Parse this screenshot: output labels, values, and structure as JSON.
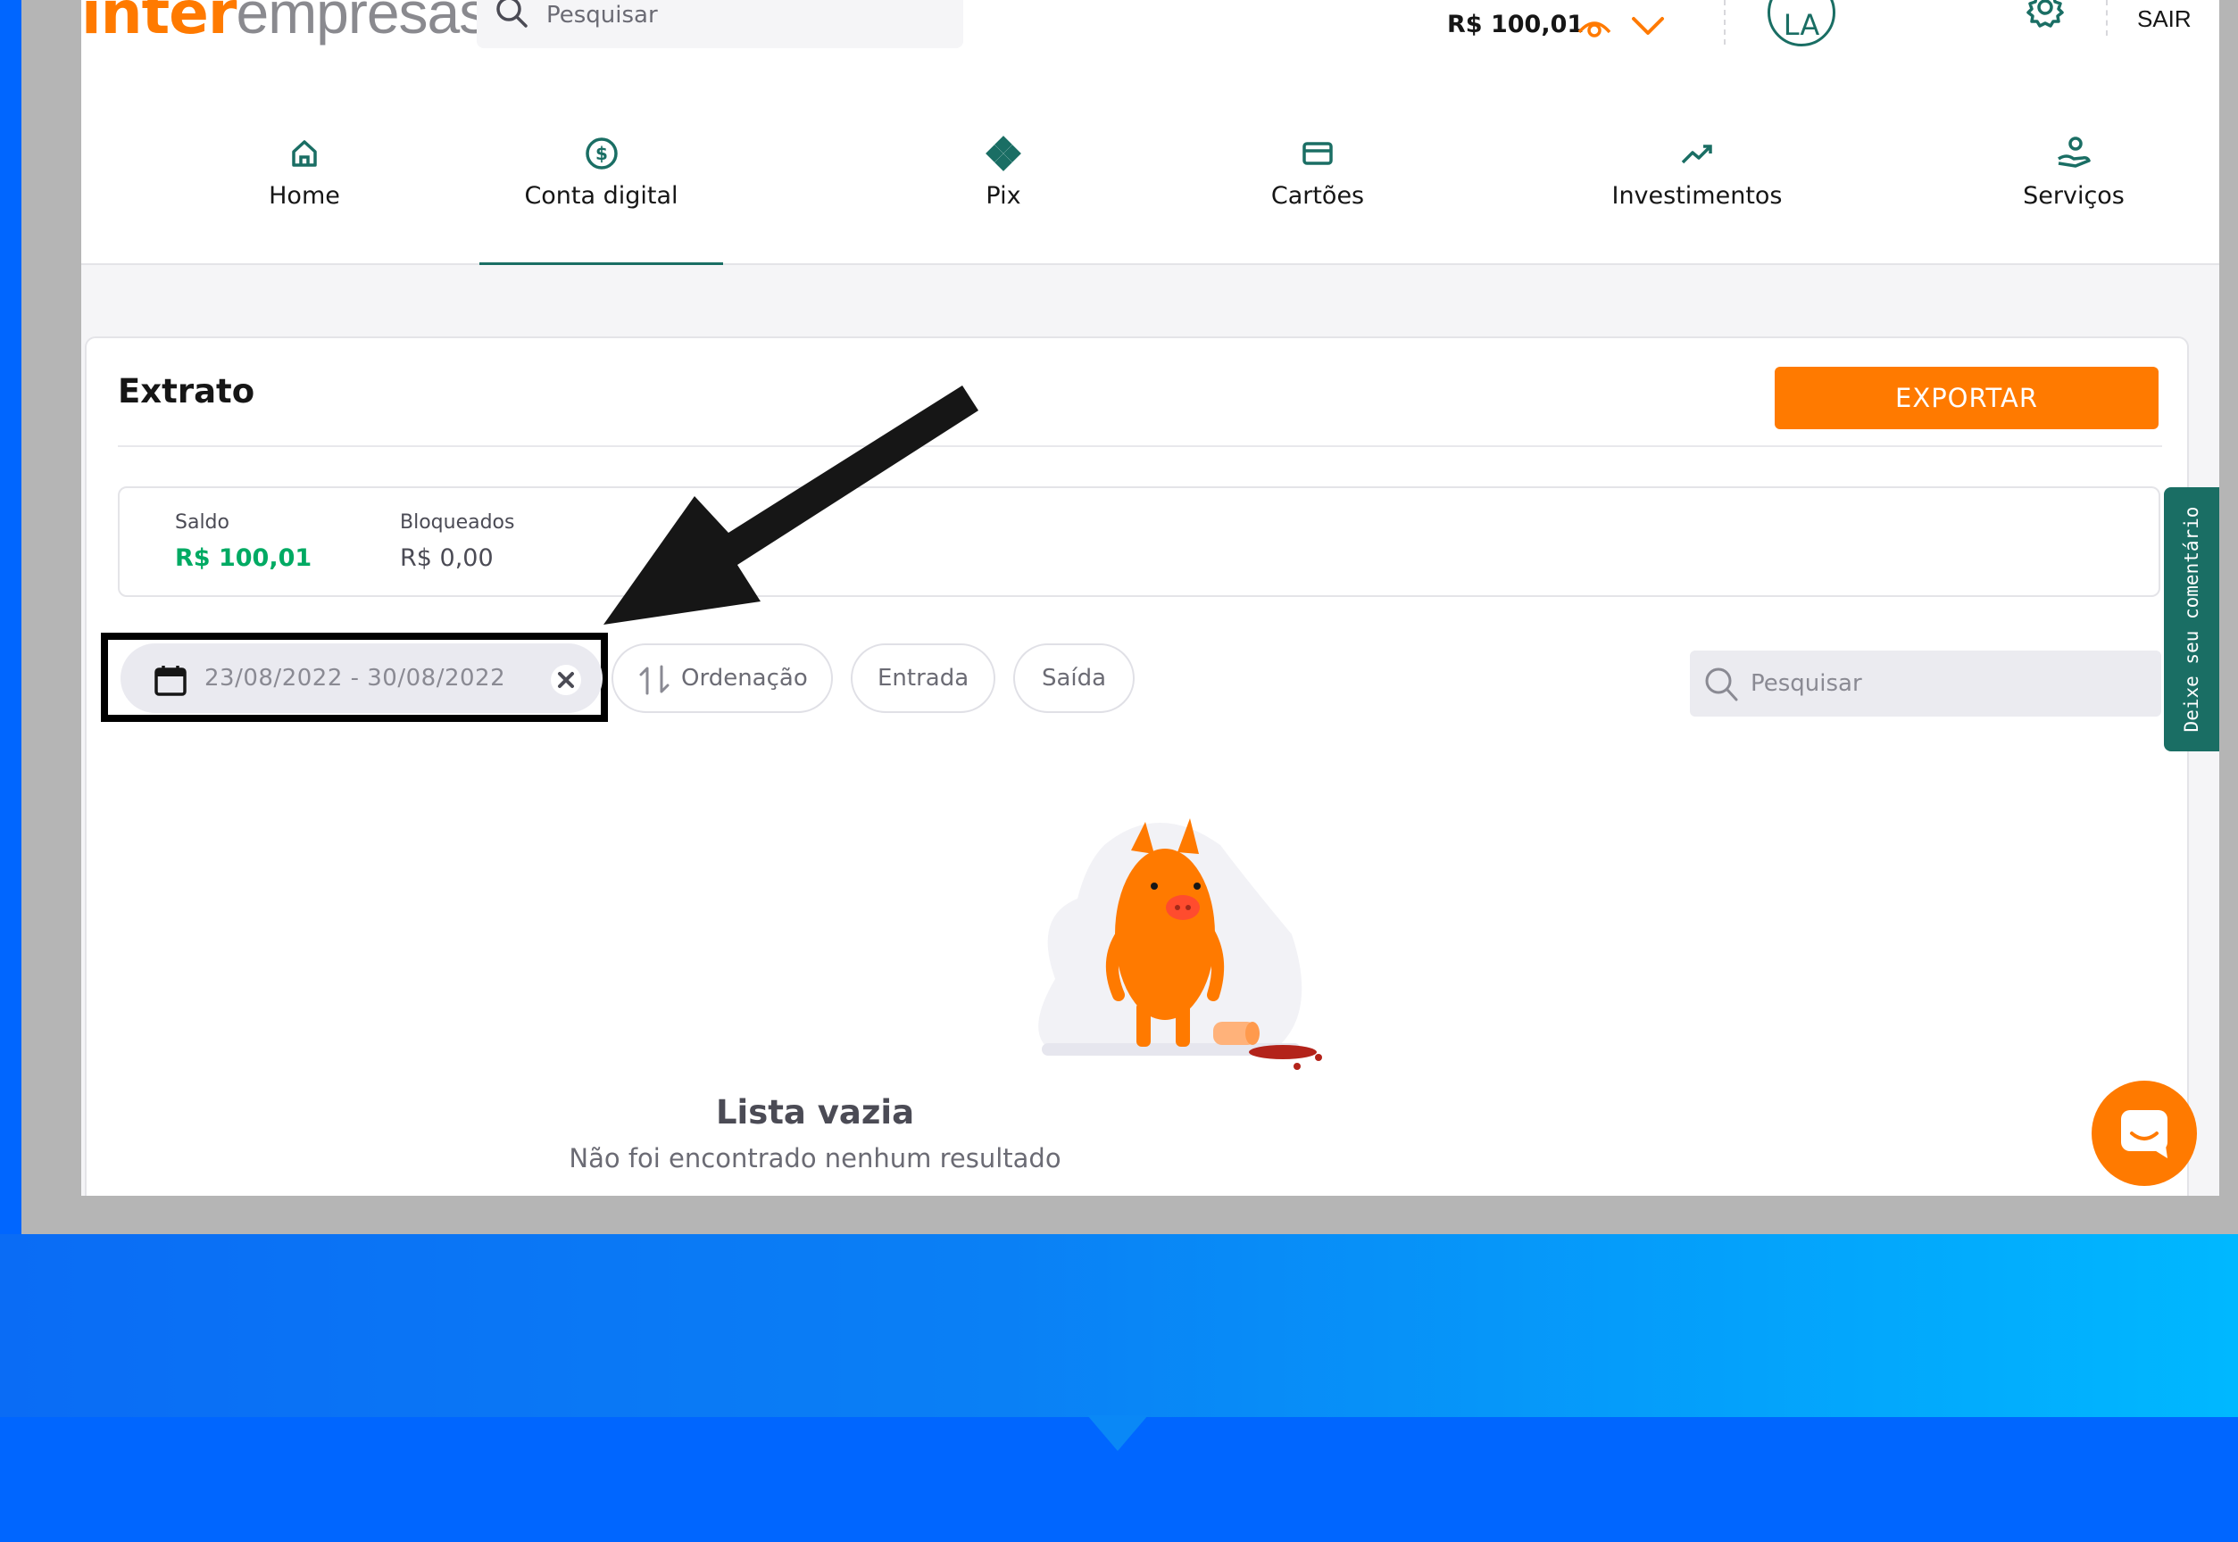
{
  "header": {
    "logo_bold": "inter",
    "logo_light": "empresas",
    "search_placeholder": "Pesquisar",
    "balance": "R$ 100,01",
    "avatar_initials": "LA",
    "logout_label": "SAIR"
  },
  "nav": [
    {
      "label": "Home",
      "icon": "home-icon"
    },
    {
      "label": "Conta digital",
      "icon": "dollar-circle-icon",
      "active": true
    },
    {
      "label": "Pix",
      "icon": "pix-icon"
    },
    {
      "label": "Cartões",
      "icon": "card-icon"
    },
    {
      "label": "Investimentos",
      "icon": "trending-up-icon"
    },
    {
      "label": "Serviços",
      "icon": "hand-coin-icon"
    }
  ],
  "extrato": {
    "title": "Extrato",
    "export_label": "EXPORTAR",
    "saldo_label": "Saldo",
    "saldo_value": "R$ 100,01",
    "bloqueados_label": "Bloqueados",
    "bloqueados_value": "R$ 0,00",
    "date_range": "23/08/2022 - 30/08/2022",
    "sort_label": "Ordenação",
    "entrada_label": "Entrada",
    "saida_label": "Saída",
    "search_placeholder": "Pesquisar",
    "empty_title": "Lista vazia",
    "empty_subtitle": "Não foi encontrado nenhum resultado"
  },
  "feedback_label": "Deixe seu comentário",
  "colors": {
    "brand_orange": "#ff7a00",
    "brand_green": "#1a6e64",
    "positive_green": "#00aa63",
    "background_blue": "#0066ff"
  }
}
